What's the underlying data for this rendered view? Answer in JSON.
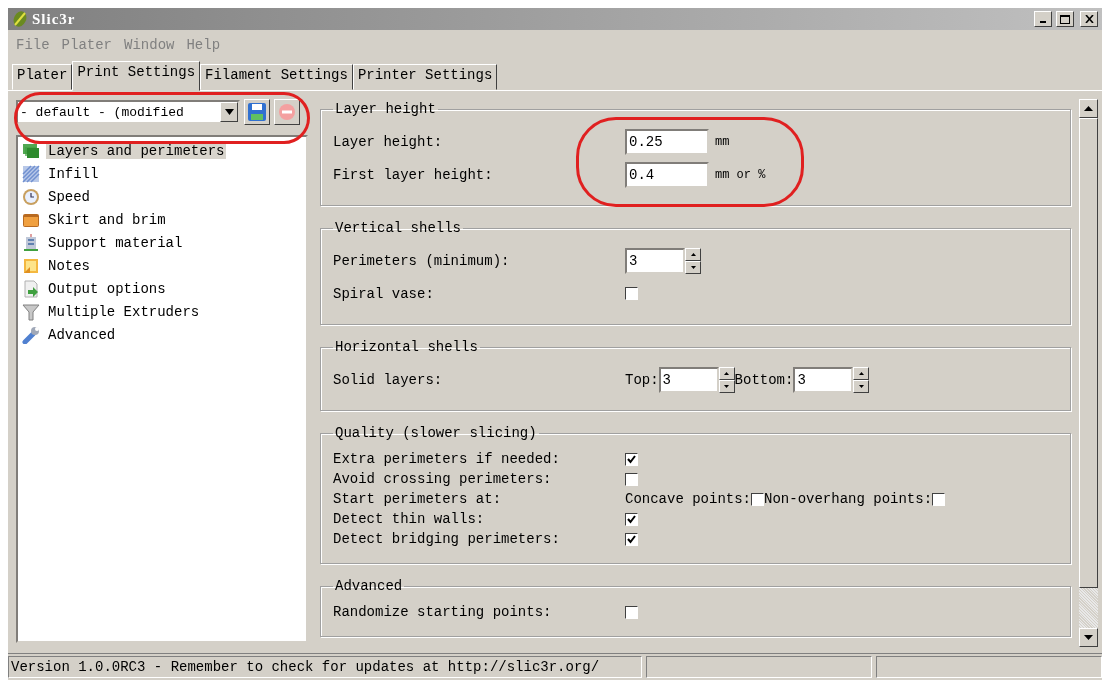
{
  "window": {
    "title": "Slic3r"
  },
  "menu": [
    "File",
    "Plater",
    "Window",
    "Help"
  ],
  "tabs": [
    {
      "label": "Plater",
      "selected": false
    },
    {
      "label": "Print Settings",
      "selected": true
    },
    {
      "label": "Filament Settings",
      "selected": false
    },
    {
      "label": "Printer Settings",
      "selected": false
    }
  ],
  "preset": {
    "value": "- default - (modified"
  },
  "sidebar": {
    "items": [
      {
        "label": "Layers and perimeters",
        "selected": true
      },
      {
        "label": "Infill",
        "selected": false
      },
      {
        "label": "Speed",
        "selected": false
      },
      {
        "label": "Skirt and brim",
        "selected": false
      },
      {
        "label": "Support material",
        "selected": false
      },
      {
        "label": "Notes",
        "selected": false
      },
      {
        "label": "Output options",
        "selected": false
      },
      {
        "label": "Multiple Extruders",
        "selected": false
      },
      {
        "label": "Advanced",
        "selected": false
      }
    ]
  },
  "sections": [
    {
      "title": "Layer height",
      "rows": [
        {
          "kind": "text",
          "label": "Layer height:",
          "value": "0.25",
          "unit": "mm"
        },
        {
          "kind": "text",
          "label": "First layer height:",
          "value": "0.4",
          "unit": "mm or %"
        }
      ]
    },
    {
      "title": "Vertical shells",
      "rows": [
        {
          "kind": "spin",
          "label": "Perimeters (minimum):",
          "value": "3"
        },
        {
          "kind": "checkbox",
          "label": "Spiral vase:",
          "checked": false
        }
      ]
    },
    {
      "title": "Horizontal shells",
      "rows": [
        {
          "kind": "spin_pair",
          "label": "Solid layers:",
          "fields": [
            {
              "label": "Top:",
              "value": "3"
            },
            {
              "label": "Bottom:",
              "value": "3"
            }
          ]
        }
      ]
    },
    {
      "title": "Quality (slower slicing)",
      "rows": [
        {
          "kind": "checkbox",
          "label": "Extra perimeters if needed:",
          "checked": true
        },
        {
          "kind": "checkbox",
          "label": "Avoid crossing perimeters:",
          "checked": false
        },
        {
          "kind": "checkbox_pair",
          "label": "Start perimeters at:",
          "options": [
            {
              "label": "Concave points:",
              "checked": false
            },
            {
              "label": "Non-overhang points:",
              "checked": false
            }
          ]
        },
        {
          "kind": "checkbox",
          "label": "Detect thin walls:",
          "checked": true
        },
        {
          "kind": "checkbox",
          "label": "Detect bridging perimeters:",
          "checked": true
        }
      ]
    },
    {
      "title": "Advanced",
      "rows": [
        {
          "kind": "checkbox",
          "label": "Randomize starting points:",
          "checked": false
        }
      ]
    }
  ],
  "status_bar": {
    "message": "Version 1.0.0RC3 - Remember to check for updates at http://slic3r.org/"
  }
}
